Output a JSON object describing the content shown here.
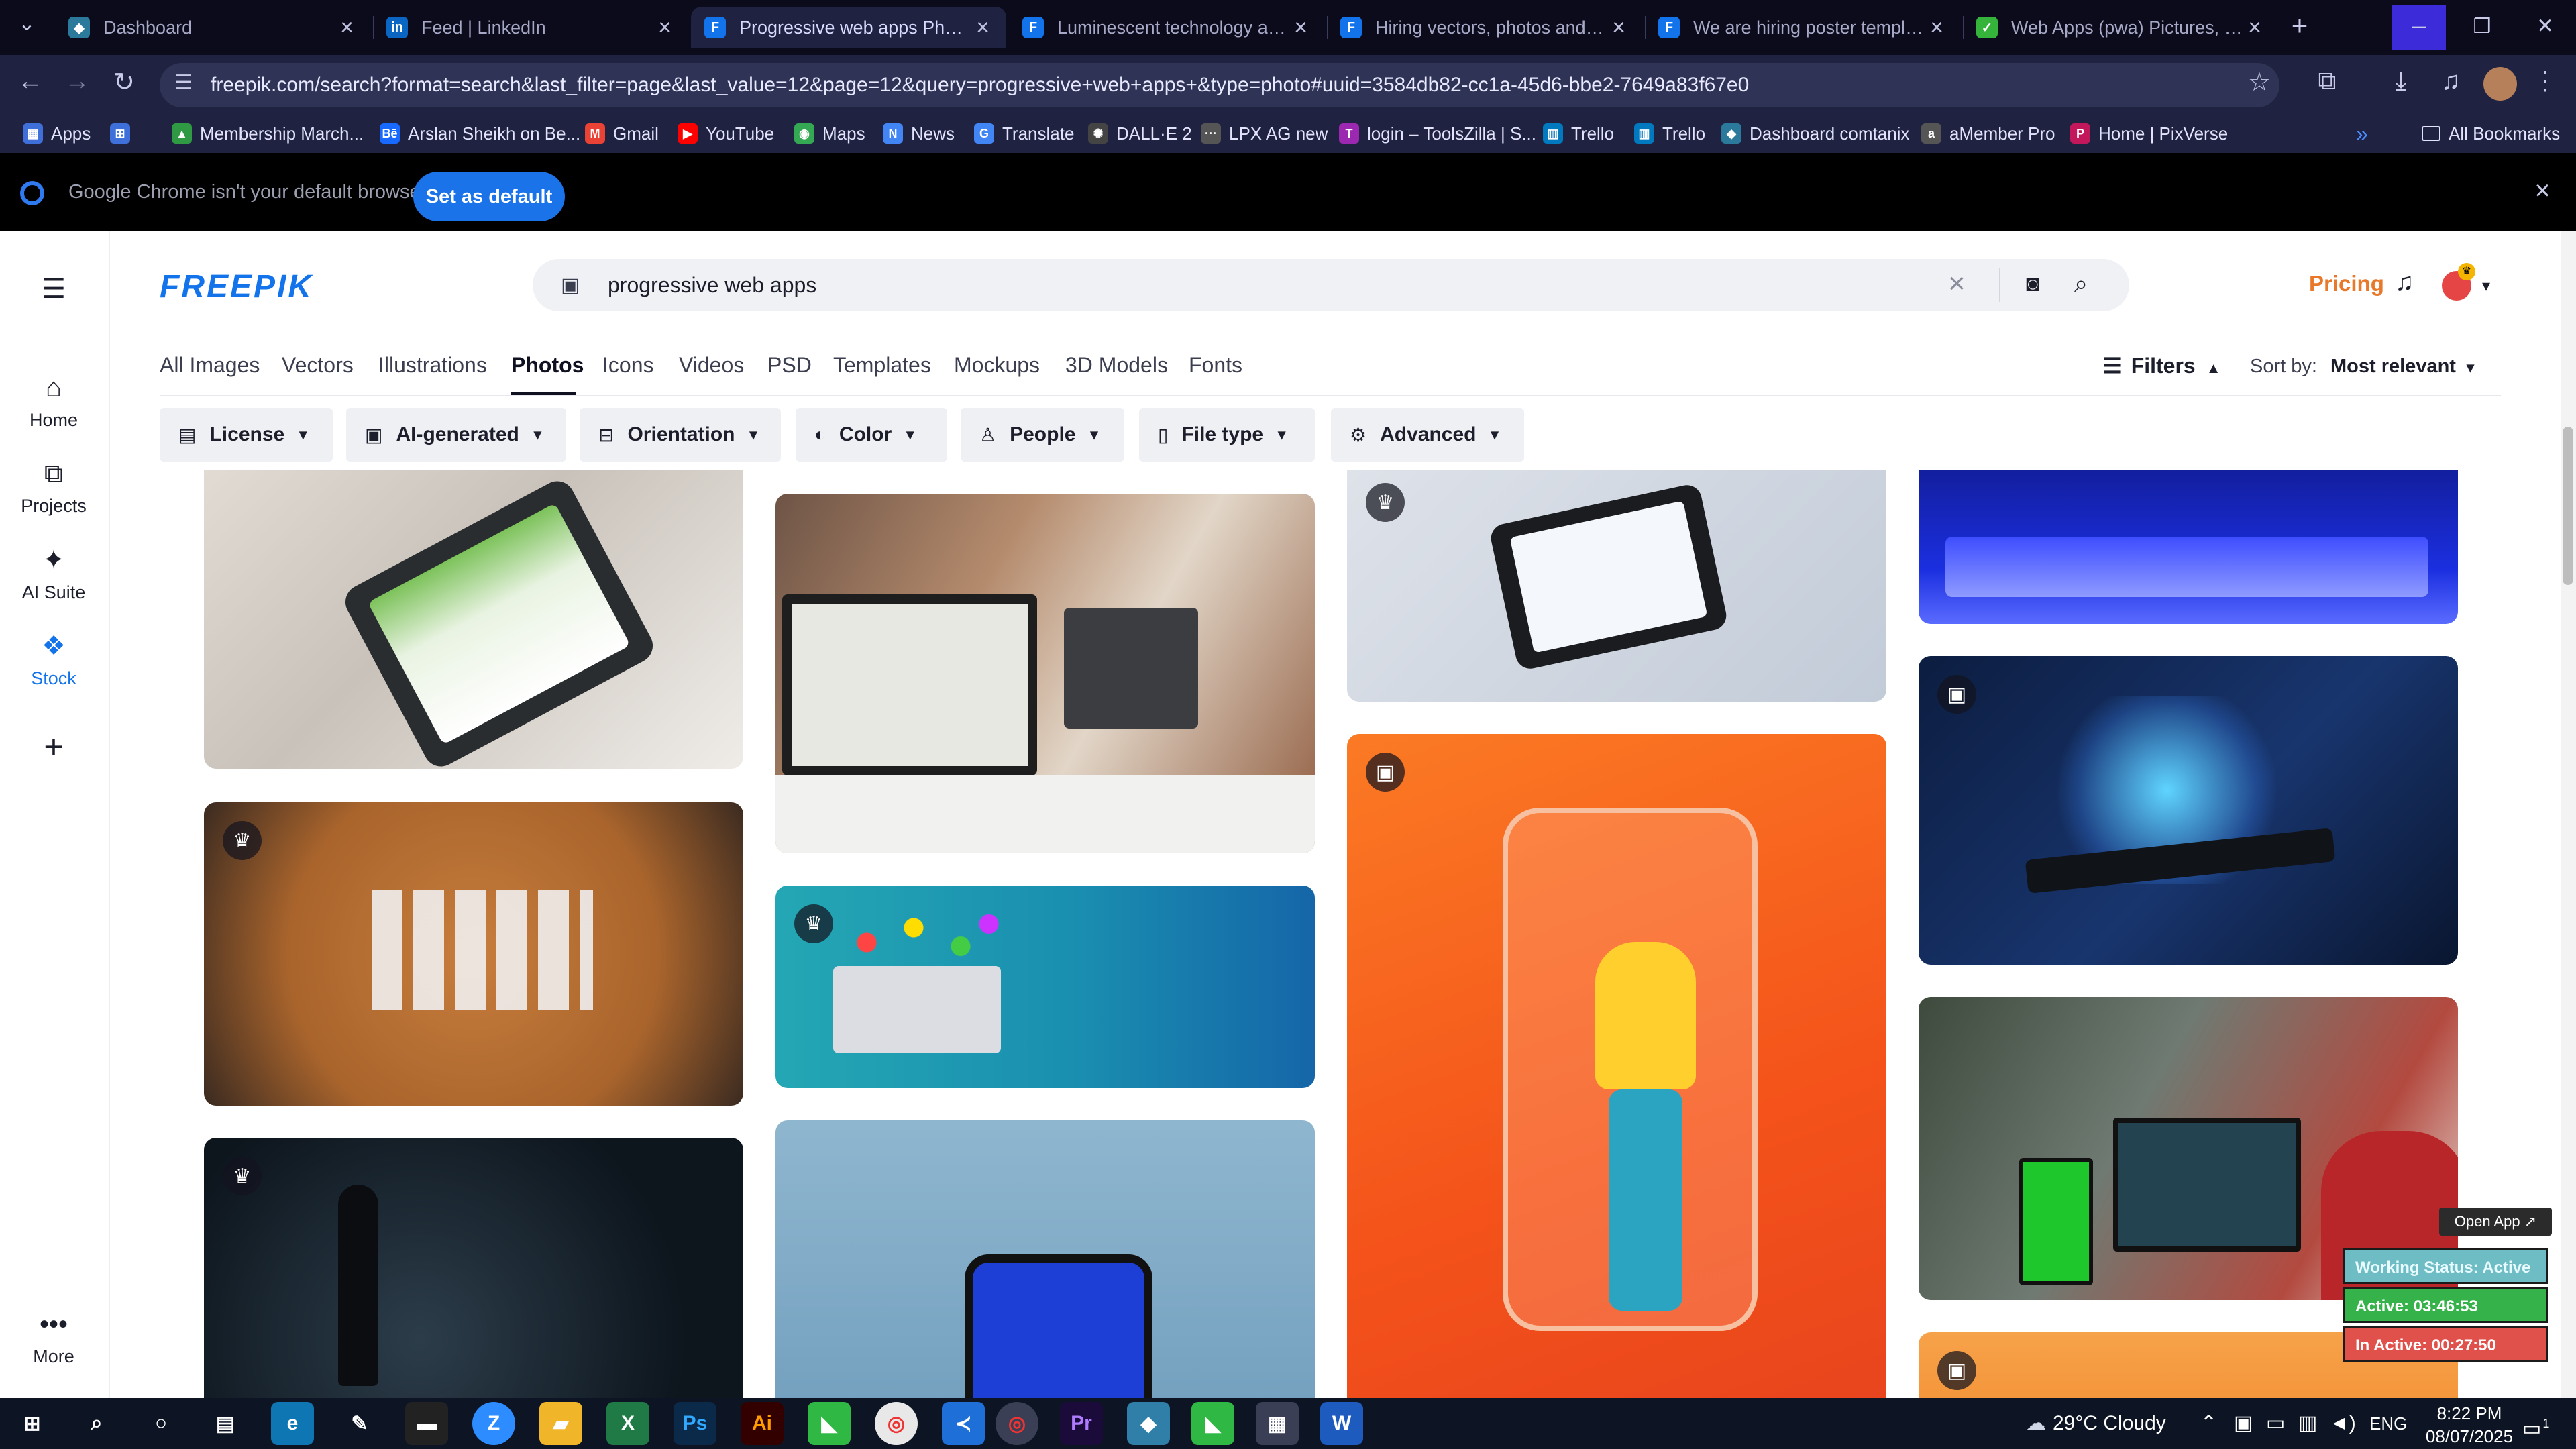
{
  "browser": {
    "tabs": [
      {
        "title": "Dashboard",
        "icon": "dashboard-app-icon",
        "color": "#2b7a9b"
      },
      {
        "title": "Feed | LinkedIn",
        "icon": "linkedin-icon",
        "color": "#0a66c2"
      },
      {
        "title": "Progressive web apps Photos | ",
        "icon": "freepik-icon",
        "color": "#1273eb"
      },
      {
        "title": "Luminescent technology and ac",
        "icon": "freepik-icon",
        "color": "#1273eb"
      },
      {
        "title": "Hiring vectors, photos and PSD",
        "icon": "freepik-icon",
        "color": "#1273eb"
      },
      {
        "title": "We are hiring poster template",
        "icon": "freepik-icon",
        "color": "#1273eb"
      },
      {
        "title": "Web Apps (pwa) Pictures, Imag",
        "icon": "page-green-icon",
        "color": "#36b33b"
      }
    ],
    "active_tab": 2,
    "url": "freepik.com/search?format=search&last_filter=page&last_value=12&page=12&query=progressive+web+apps+&type=photo#uuid=3584db82-cc1a-45d6-bbe2-7649a83f67e0",
    "bookmarks": [
      {
        "label": "Apps",
        "icon": "apps-grid-icon",
        "color": "#3f6fd8"
      },
      {
        "label": "",
        "icon": "grid-icon",
        "color": "#3f6fd8"
      },
      {
        "label": "Membership March...",
        "icon": "membership-icon",
        "color": "#2f9a43"
      },
      {
        "label": "Arslan Sheikh on Be...",
        "icon": "behance-icon",
        "color": "#1769ff"
      },
      {
        "label": "Gmail",
        "icon": "gmail-icon",
        "color": "#ea4335"
      },
      {
        "label": "YouTube",
        "icon": "youtube-icon",
        "color": "#ff0000"
      },
      {
        "label": "Maps",
        "icon": "maps-icon",
        "color": "#34a853"
      },
      {
        "label": "News",
        "icon": "news-icon",
        "color": "#4285f4"
      },
      {
        "label": "Translate",
        "icon": "translate-icon",
        "color": "#4285f4"
      },
      {
        "label": "DALL·E 2",
        "icon": "openai-icon",
        "color": "#444444"
      },
      {
        "label": "LPX AG new",
        "icon": "dots-icon",
        "color": "#555555"
      },
      {
        "label": "login – ToolsZilla | S...",
        "icon": "toolszilla-icon",
        "color": "#9c27b0"
      },
      {
        "label": "Trello",
        "icon": "trello-icon",
        "color": "#0079bf"
      },
      {
        "label": "Trello",
        "icon": "trello-icon",
        "color": "#0079bf"
      },
      {
        "label": "Dashboard comtanix",
        "icon": "dashboard-app-icon",
        "color": "#2b7a9b"
      },
      {
        "label": "aMember Pro",
        "icon": "amember-icon",
        "color": "#555555"
      },
      {
        "label": "Home | PixVerse",
        "icon": "pixverse-icon",
        "color": "#c2185b"
      }
    ],
    "all_bookmarks": "All Bookmarks",
    "infobar": {
      "message": "Google Chrome isn't your default browser",
      "button": "Set as default"
    }
  },
  "freepik": {
    "logo": "FREEPIK",
    "search_value": "progressive web apps",
    "pricing": "Pricing",
    "sidebar": [
      {
        "label": "Home",
        "icon": "home-icon"
      },
      {
        "label": "Projects",
        "icon": "projects-icon"
      },
      {
        "label": "AI Suite",
        "icon": "ai-suite-icon"
      },
      {
        "label": "Stock",
        "icon": "stock-icon"
      },
      {
        "label": "",
        "icon": "plus-icon"
      },
      {
        "label": "More",
        "icon": "more-dots-icon"
      }
    ],
    "tabs": [
      "All Images",
      "Vectors",
      "Illustrations",
      "Photos",
      "Icons",
      "Videos",
      "PSD",
      "Templates",
      "Mockups",
      "3D Models",
      "Fonts"
    ],
    "active_tab": "Photos",
    "filters_label": "Filters",
    "sort_label": "Sort by:",
    "sort_value": "Most relevant",
    "chips": [
      {
        "label": "License",
        "icon": "license-icon"
      },
      {
        "label": "AI-generated",
        "icon": "ai-generated-icon"
      },
      {
        "label": "Orientation",
        "icon": "orientation-icon"
      },
      {
        "label": "Color",
        "icon": "color-palette-icon"
      },
      {
        "label": "People",
        "icon": "people-icon"
      },
      {
        "label": "File type",
        "icon": "file-icon"
      },
      {
        "label": "Advanced",
        "icon": "settings-icon"
      }
    ]
  },
  "widget": {
    "open_app": "Open App ↗",
    "status": "Working Status: Active",
    "active": "Active: 03:46:53",
    "inactive": "In Active: 00:27:50"
  },
  "taskbar": {
    "weather": "29°C  Cloudy",
    "lang": "ENG",
    "time": "8:22 PM",
    "date": "08/07/2025",
    "notification_count": "1"
  }
}
